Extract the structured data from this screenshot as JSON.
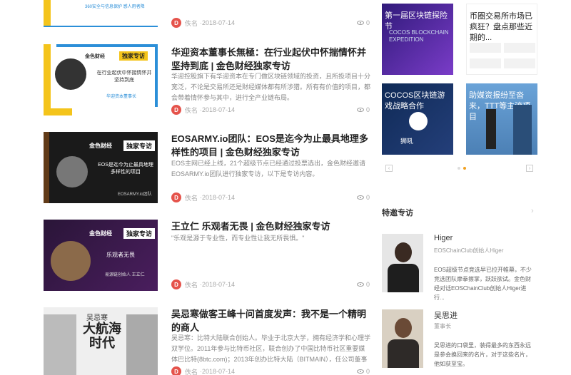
{
  "articles": [
    {
      "thumb_text": "360安全与信息保护 感人用者降",
      "title": "",
      "excerpt": "",
      "author_logo": "D",
      "author": "佚名",
      "date": "2018-07-14",
      "views": "0"
    },
    {
      "thumb_brand": "金色财经",
      "thumb_tag": "独家专访",
      "thumb_quote": "在行业起伏中怀揣情怀并坚持到底",
      "thumb_who": "华迎资本董事长",
      "title": "华迎资本董事长無極：在行业起伏中怀揣情怀并坚持到底 | 金色财经独家专访",
      "excerpt": "华迎控股旗下有华迎资本在专门做区块链领域的投资，且所投项目十分宽泛，不论是交易所还是财经媒体都有所涉猎。所有有价值的项目，都会带着情怀参与其中，进行全产业链布局。",
      "author_logo": "D",
      "author": "佚名",
      "date": "2018-07-14",
      "views": "0"
    },
    {
      "thumb_brand": "金色财经",
      "thumb_tag": "独家专访",
      "thumb_quote": "EOS是迄今为止最具地理多样性的项目",
      "thumb_who": "EOSARMY.io团队",
      "title": "EOSARMY.io团队：EOS是迄今为止最具地理多样性的项目 | 金色财经独家专访",
      "excerpt": "EOS主网已经上线，21个超级节点已经通过投票选出，金色财经邀请EOSARMY.io团队进行独家专访，以下是专访内容。",
      "author_logo": "D",
      "author": "佚名",
      "date": "2018-07-14",
      "views": "0"
    },
    {
      "thumb_brand": "金色财经",
      "thumb_tag": "独家专访",
      "thumb_quote": "乐观者无畏",
      "thumb_who": "易源链创始人 王立仁",
      "title": "王立仁 乐观者无畏 | 金色财经独家专访",
      "excerpt": "\"乐观是源于专业性，而专业性让我无所畏惧。\"",
      "author_logo": "D",
      "author": "佚名",
      "date": "2018-07-14",
      "views": "0"
    },
    {
      "thumb_small": "吴忌寒",
      "thumb_big": "大航海时代",
      "title": "吴忌寒做客王峰十问首度发声：我不是一个精明的商人",
      "excerpt": "吴忌寒：比特大陆联合创始人。毕业于北京大学，拥有经济学和心理学双学位。2011年参与比特币社区，联合创办了中国比特币社区重要媒体巴比特(8btc.com)；2013年创办比特大陆（BITMAIN），任公司董事和联合CEO...",
      "author_logo": "D",
      "author": "佚名",
      "date": "2018-07-14",
      "views": "0"
    }
  ],
  "banners": [
    {
      "caption": "第一届区块链探险节",
      "sub": "COCOS BLOCKCHAIN EXPEDITION"
    },
    {
      "caption": "币圈交易所市场已疯狂？盘点那些近期的..."
    },
    {
      "caption": "COCOS区块链游戏战略合作",
      "foot": "狮吼"
    },
    {
      "caption": "助媒资报纷至沓来，TTT等主流项目"
    }
  ],
  "featured": {
    "title": "特邀专访",
    "more": "›",
    "people": [
      {
        "name": "Higer",
        "role": "EOSChainClub创始人Higer",
        "desc": "EOS超级节点竞选早已拉开帷幕，不少竞选团队摩拳擦掌，跃跃欲试。金色财经对话EOSChainClub创始人Higer进行..."
      },
      {
        "name": "吴思进",
        "role": "董事长",
        "desc": "吴思进的口袋里，装得最多的东西永远是参会换回来的名片，对于这些名片，他如获至宝。"
      }
    ]
  }
}
